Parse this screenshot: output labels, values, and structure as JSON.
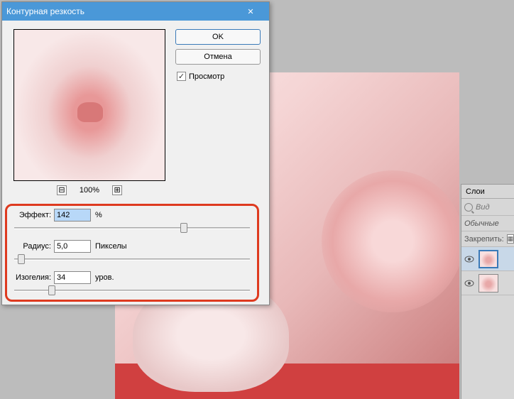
{
  "dialog": {
    "title": "Контурная резкость",
    "buttons": {
      "ok": "OK",
      "cancel": "Отмена"
    },
    "preview_checkbox": "Просмотр",
    "zoom": {
      "level": "100%",
      "minus": "⊟",
      "plus": "⊞"
    },
    "controls": {
      "effect": {
        "label": "Эффект:",
        "value": "142",
        "unit": "%",
        "pos": 72
      },
      "radius": {
        "label": "Радиус:",
        "value": "5,0",
        "unit": "Пикселы",
        "pos": 3
      },
      "threshold": {
        "label": "Изогелия:",
        "value": "34",
        "unit": "уров.",
        "pos": 16
      }
    }
  },
  "layers": {
    "tab": "Слои",
    "search_placeholder": "Вид",
    "blend_mode": "Обычные",
    "lock_label": "Закрепить:"
  }
}
